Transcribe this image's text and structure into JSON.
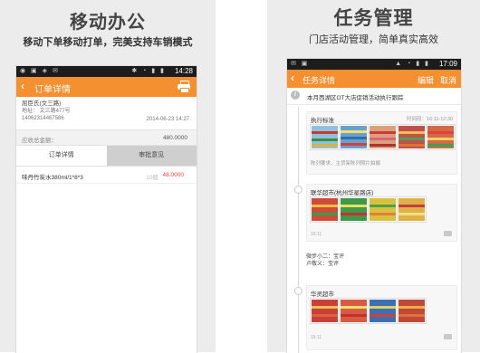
{
  "left": {
    "title": "移动办公",
    "subtitle": "移动下单移动打单，完美支持车销模式",
    "status_time": "14:28",
    "app_bar_title": "订单详情",
    "customer": {
      "name": "屈臣氏(文三路)",
      "address": "地址：  文三路477号",
      "phone": "14062314467586",
      "datetime": "2014-06-23 14:27"
    },
    "amount_label": "应收总金额：",
    "amount_value": "480.0000",
    "tabs": [
      "订单详情",
      "审批意见"
    ],
    "items": [
      {
        "name": "味丹竹炭水380ml/1*8*3",
        "qty": "10瓶",
        "price": "48.0000"
      }
    ],
    "icons": {
      "back": "back-arrow-icon",
      "print": "printer-icon"
    }
  },
  "right": {
    "title": "任务管理",
    "subtitle": "门店活动管理，简单真实高效",
    "status_time": "17:09",
    "app_bar_title": "任务详情",
    "edit_label": "编辑",
    "cancel_label": "取消",
    "task_title": "本月西湖区OT大店促销活动执行跟踪",
    "cards": [
      {
        "title": "执行标准",
        "time": "时间段：16:11-12:30",
        "note": "陈列要求，主货架陈列照片拍摄"
      },
      {
        "title": "联华超市(杭州华星路店)",
        "footer": "16:11"
      }
    ],
    "reply": {
      "line1": "微步小二：宝评",
      "line2": "卢敬义：宝评"
    },
    "card3": {
      "title": "华灵超市",
      "footer": "16:11"
    }
  },
  "colors": {
    "accent": "#f4902f",
    "price": "#e8473a",
    "bg": "#ececec"
  }
}
